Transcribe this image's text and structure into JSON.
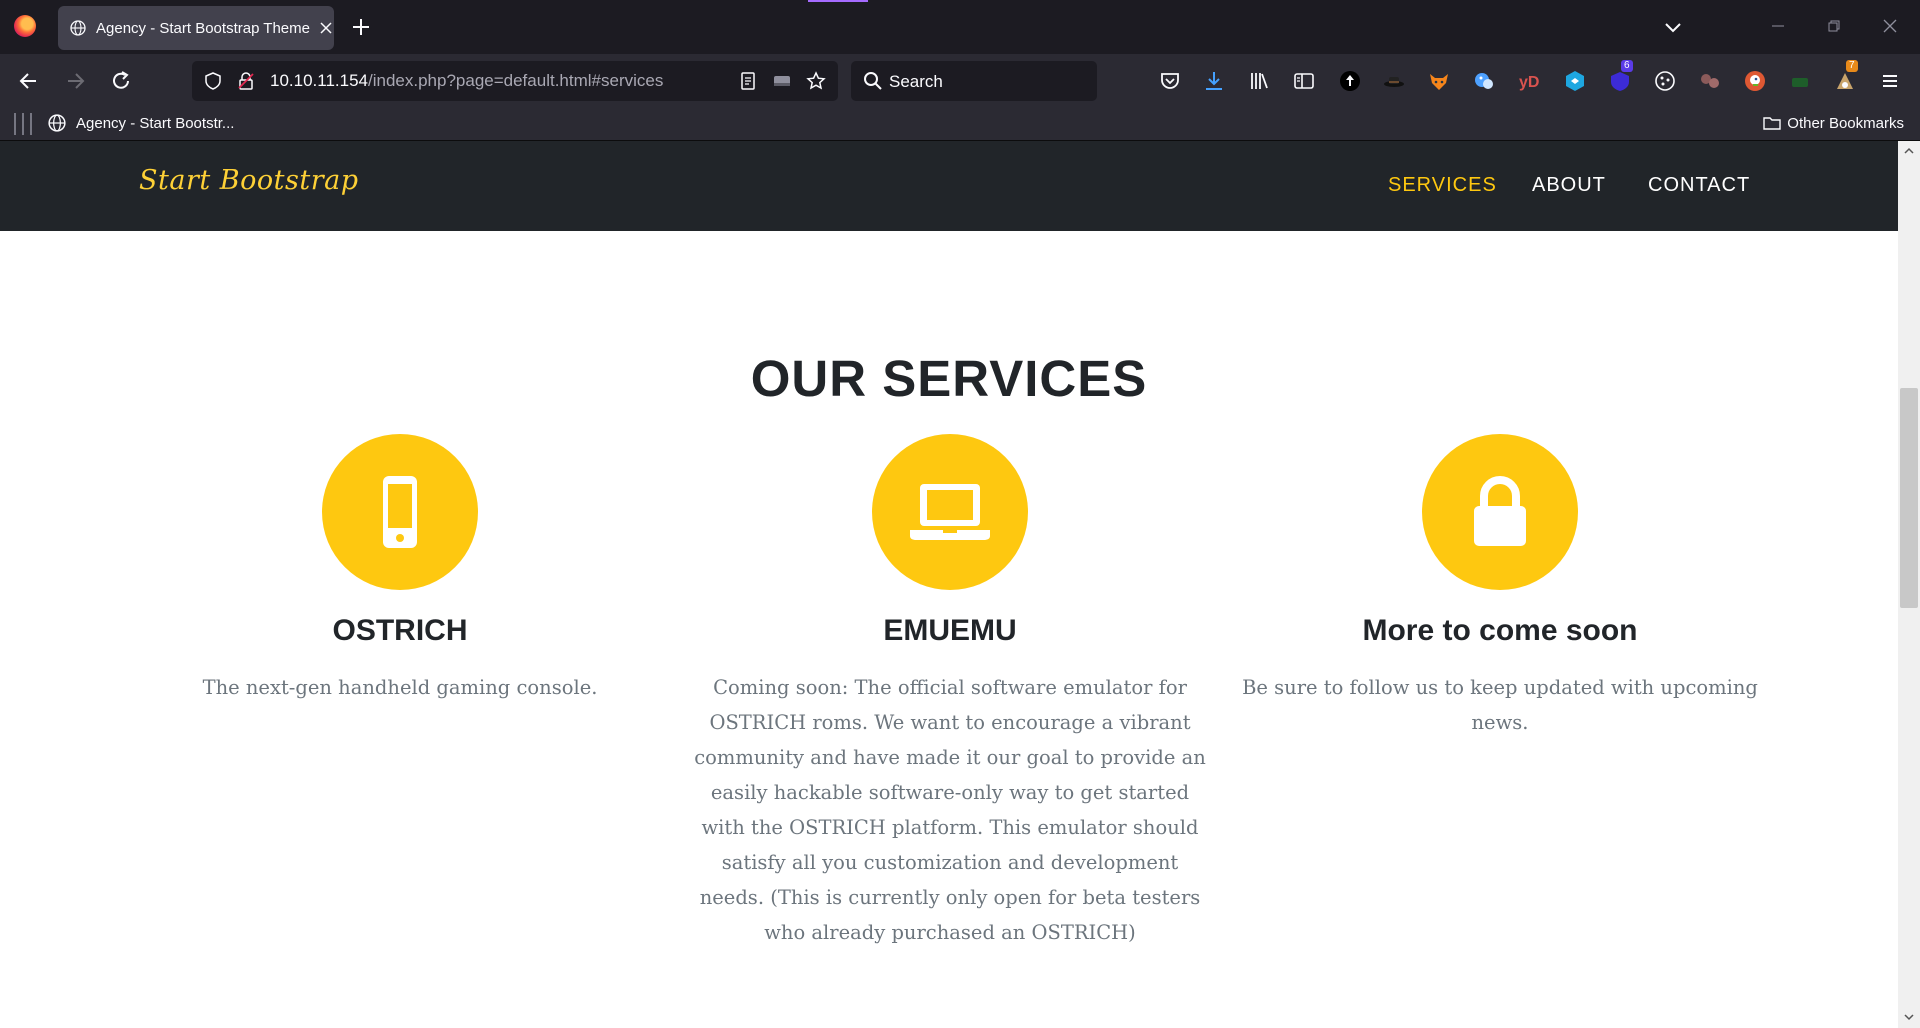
{
  "browser": {
    "tab_title": "Agency - Start Bootstrap Theme",
    "url_host": "10.10.11.154",
    "url_path": "/index.php?page=default.html#services",
    "search_placeholder": "Search",
    "bookmark_item": "Agency - Start Bootstr...",
    "other_bookmarks": "Other Bookmarks",
    "badges": {
      "extension_a": "6",
      "extension_b": "7"
    }
  },
  "site": {
    "brand": "Start Bootstrap",
    "nav": [
      "SERVICES",
      "ABOUT",
      "CONTACT"
    ],
    "active_nav": "SERVICES",
    "section_heading": "OUR SERVICES",
    "services": [
      {
        "icon": "mobile-phone-icon",
        "title": "OSTRICH",
        "text": "The next-gen handheld gaming console."
      },
      {
        "icon": "laptop-icon",
        "title": "EMUEMU",
        "text": "Coming soon: The official software emulator for OSTRICH roms. We want to encourage a vibrant community and have made it our goal to provide an easily hackable software-only way to get started with the OSTRICH platform. This emulator should satisfy all you customization and development needs. (This is currently only open for beta testers who already purchased an OSTRICH)"
      },
      {
        "icon": "lock-icon",
        "title": "More to come soon",
        "text": "Be sure to follow us to keep updated with upcoming news."
      }
    ]
  },
  "colors": {
    "accent": "#fec810",
    "dark": "#212529",
    "browser_bg": "#1c1b22",
    "toolbar_bg": "#2b2a33"
  }
}
